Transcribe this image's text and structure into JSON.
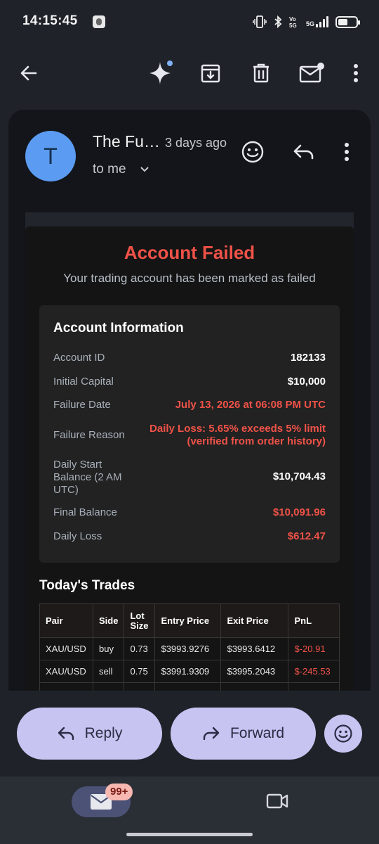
{
  "status_bar": {
    "time": "14:15:45",
    "network": "5G"
  },
  "toolbar": {
    "icons": [
      "back-arrow-icon",
      "sparkle-icon",
      "archive-icon",
      "delete-icon",
      "mark-unread-icon",
      "more-vertical-icon"
    ]
  },
  "email": {
    "avatar_letter": "T",
    "sender": "The Fu…",
    "time_ago": "3 days ago",
    "to": "to me"
  },
  "body": {
    "title": "Account Failed",
    "subtitle": "Your trading account has been marked as failed",
    "info": {
      "heading": "Account Information",
      "rows": [
        {
          "label": "Account ID",
          "value": "182133"
        },
        {
          "label": "Initial Capital",
          "value": "$10,000"
        },
        {
          "label": "Failure Date",
          "value": "July 13, 2026 at 06:08 PM UTC"
        },
        {
          "label": "Failure Reason",
          "value_line1": "Daily Loss: 5.65% exceeds 5% limit",
          "value_line2": "(verified from order history)"
        },
        {
          "label_line1": "Daily Start",
          "label_line2": "Balance (2 AM",
          "label_line3": "UTC)",
          "value": "$10,704.43"
        },
        {
          "label": "Final Balance",
          "value": "$10,091.96"
        },
        {
          "label": "Daily Loss",
          "value": "$612.47"
        }
      ]
    },
    "trades": {
      "heading": "Today's Trades",
      "columns": [
        "Pair",
        "Side",
        "Lot Size",
        "Entry Price",
        "Exit Price",
        "PnL"
      ],
      "rows": [
        {
          "pair": "XAU/USD",
          "side": "buy",
          "lot": "0.73",
          "entry": "$3993.9276",
          "exit": "$3993.6412",
          "pnl": "$-20.91"
        },
        {
          "pair": "XAU/USD",
          "side": "sell",
          "lot": "0.75",
          "entry": "$3991.9309",
          "exit": "$3995.2043",
          "pnl": "$-245.53"
        }
      ]
    }
  },
  "actions": {
    "reply": "Reply",
    "forward": "Forward"
  },
  "nav": {
    "badge": "99+"
  },
  "colors": {
    "accent_red": "#ef5248",
    "button_lavender": "#c8c4f2",
    "avatar_blue": "#5b9cf2"
  }
}
